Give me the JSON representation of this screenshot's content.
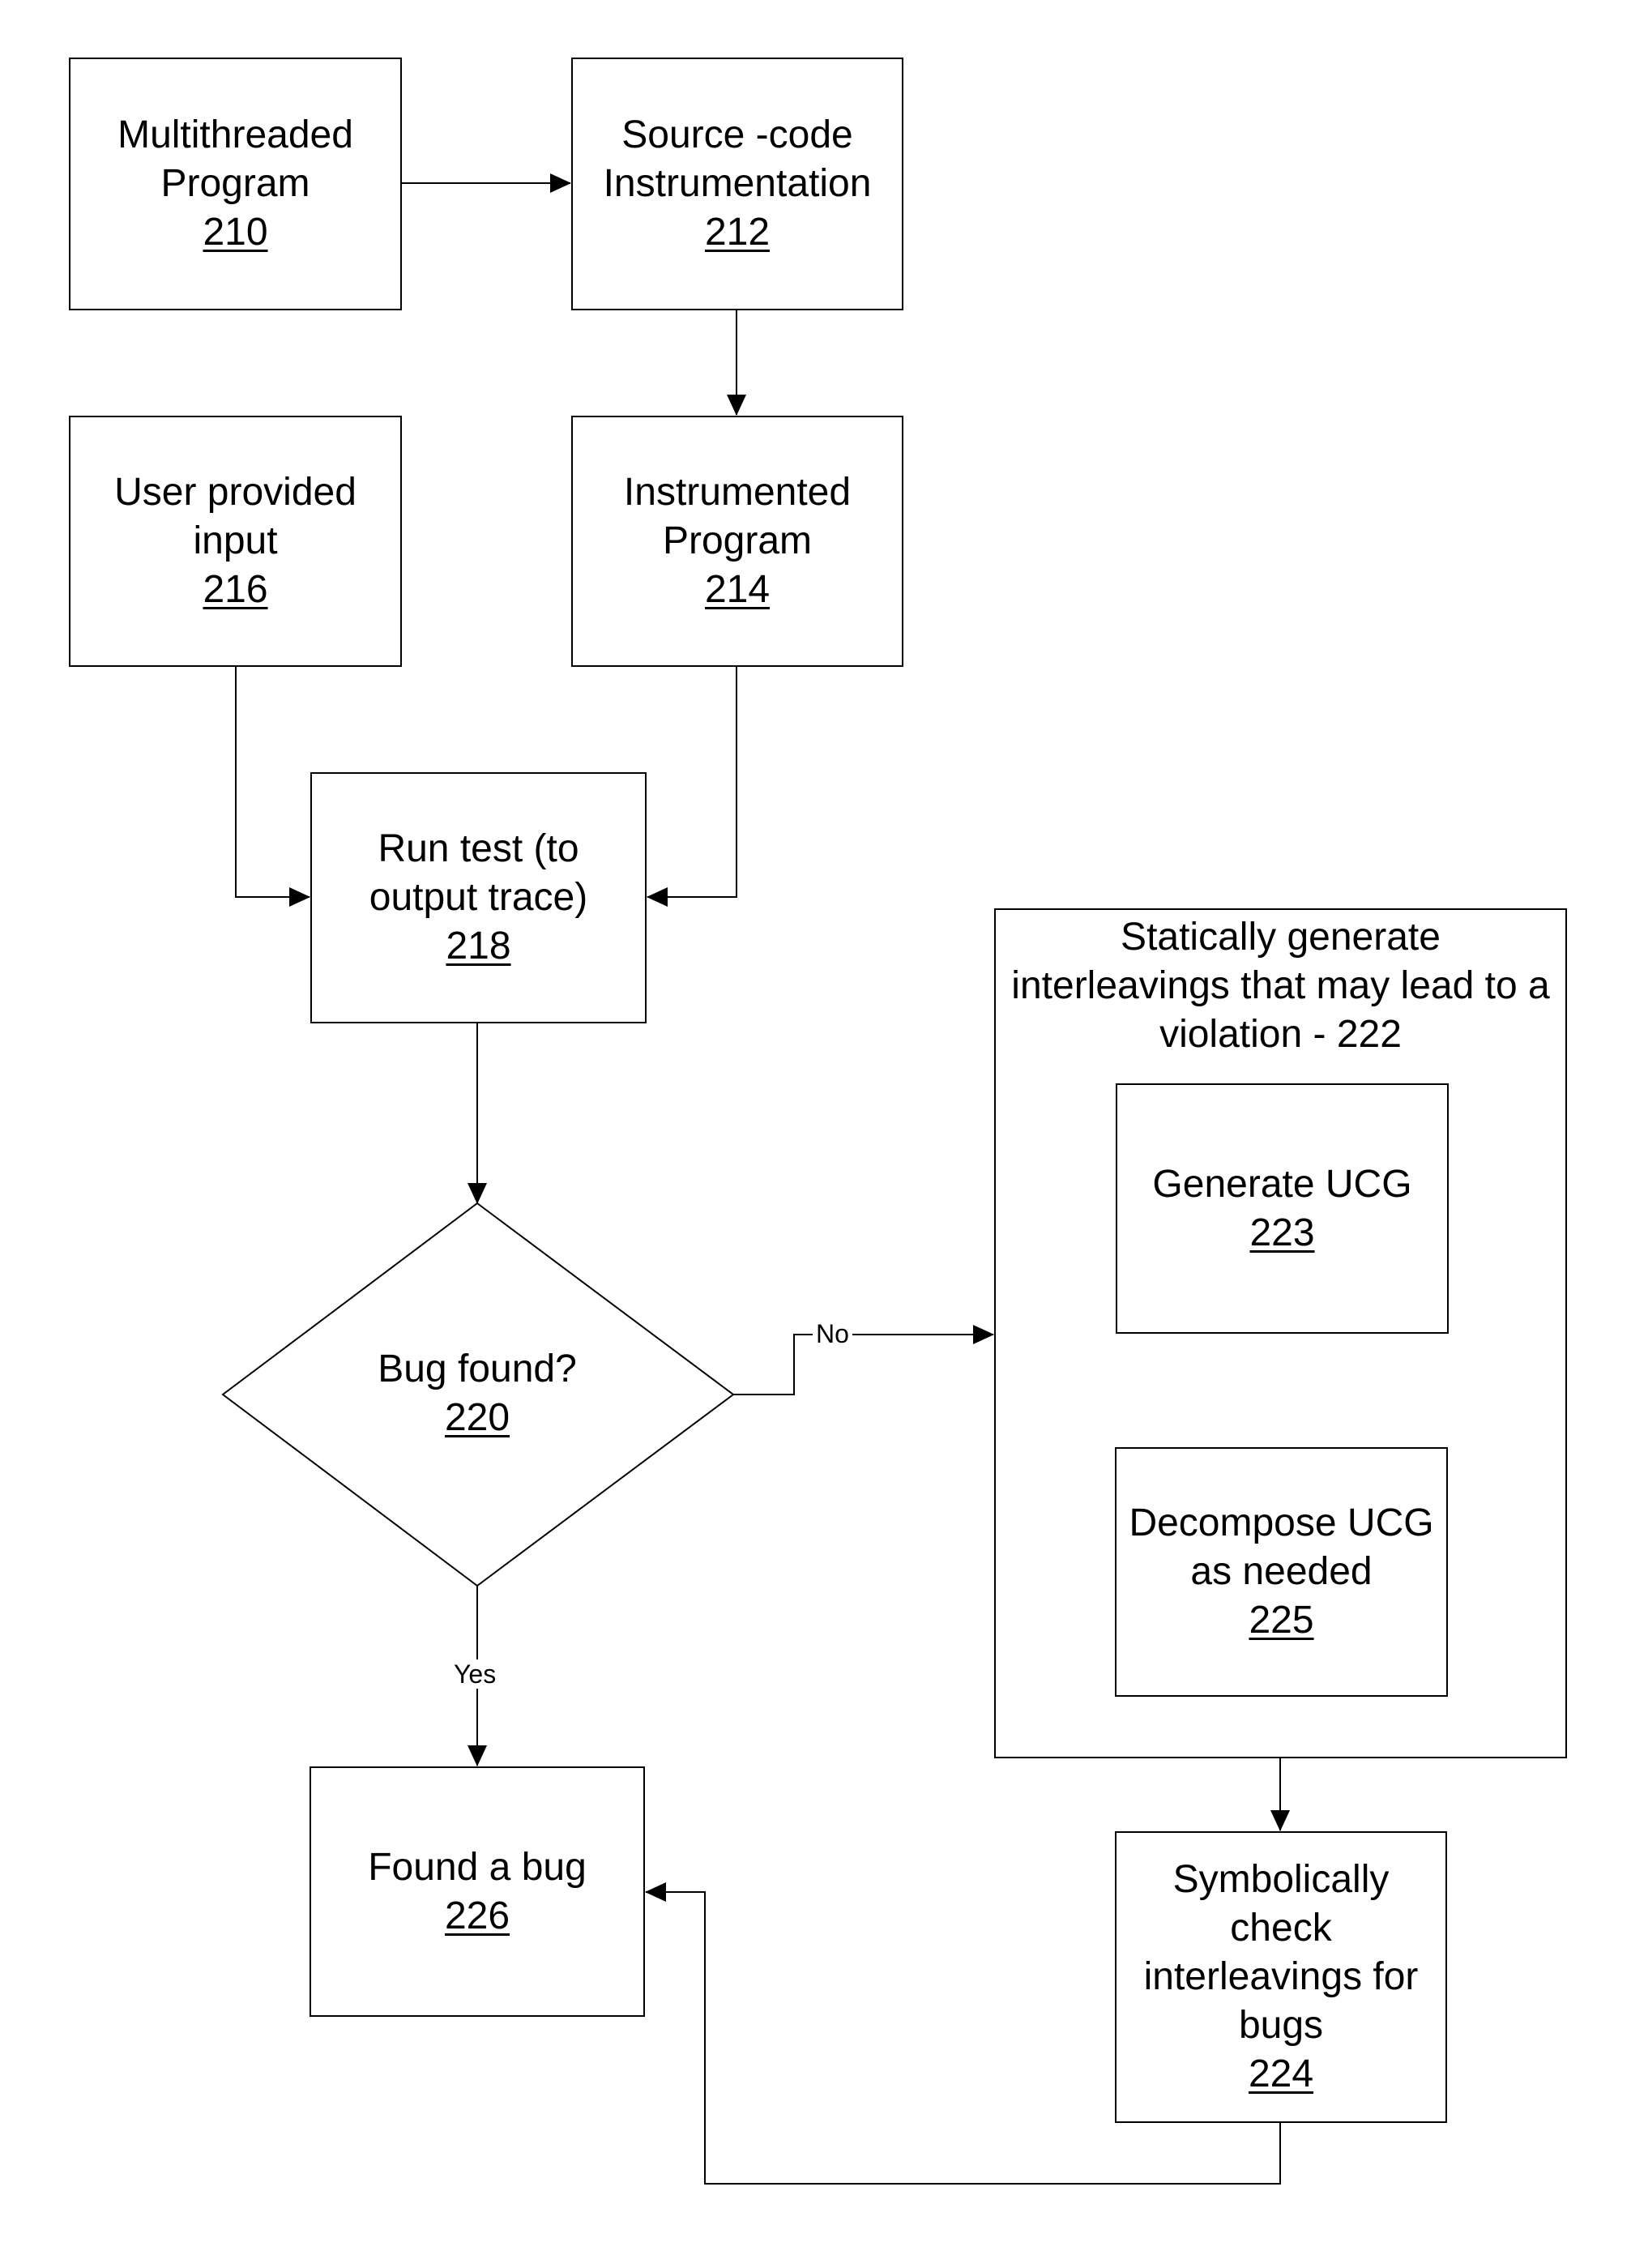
{
  "figure": {
    "nodes": {
      "n210": {
        "lines": [
          "Multithreaded",
          "Program"
        ],
        "ref": "210"
      },
      "n212": {
        "lines": [
          "Source -code",
          "Instrumentation"
        ],
        "ref": "212"
      },
      "n216": {
        "lines": [
          "User provided",
          "input"
        ],
        "ref": "216"
      },
      "n214": {
        "lines": [
          "Instrumented",
          "Program"
        ],
        "ref": "214"
      },
      "n218": {
        "lines": [
          "Run test (to",
          "output trace)"
        ],
        "ref": "218"
      },
      "n220": {
        "lines": [
          "Bug found?"
        ],
        "ref": "220",
        "shape": "decision"
      },
      "n222": {
        "lines": [
          "Statically generate",
          "interleavings that may lead to a",
          "violation - 222"
        ]
      },
      "n223": {
        "lines": [
          "Generate UCG"
        ],
        "ref": "223"
      },
      "n225": {
        "lines": [
          "Decompose UCG",
          "as needed"
        ],
        "ref": "225"
      },
      "n224": {
        "lines": [
          "Symbolically",
          "check",
          "interleavings for",
          "bugs"
        ],
        "ref": "224"
      },
      "n226": {
        "lines": [
          "Found a bug"
        ],
        "ref": "226"
      }
    },
    "edges": [
      {
        "from": "210",
        "to": "212",
        "label": ""
      },
      {
        "from": "212",
        "to": "214",
        "label": ""
      },
      {
        "from": "216",
        "to": "218",
        "label": ""
      },
      {
        "from": "214",
        "to": "218",
        "label": ""
      },
      {
        "from": "218",
        "to": "220",
        "label": ""
      },
      {
        "from": "220",
        "to": "222",
        "label": "No"
      },
      {
        "from": "220",
        "to": "226",
        "label": "Yes"
      },
      {
        "from": "222",
        "to": "224",
        "label": ""
      },
      {
        "from": "224",
        "to": "226",
        "label": ""
      }
    ],
    "edge_labels": {
      "no": "No",
      "yes": "Yes"
    }
  }
}
